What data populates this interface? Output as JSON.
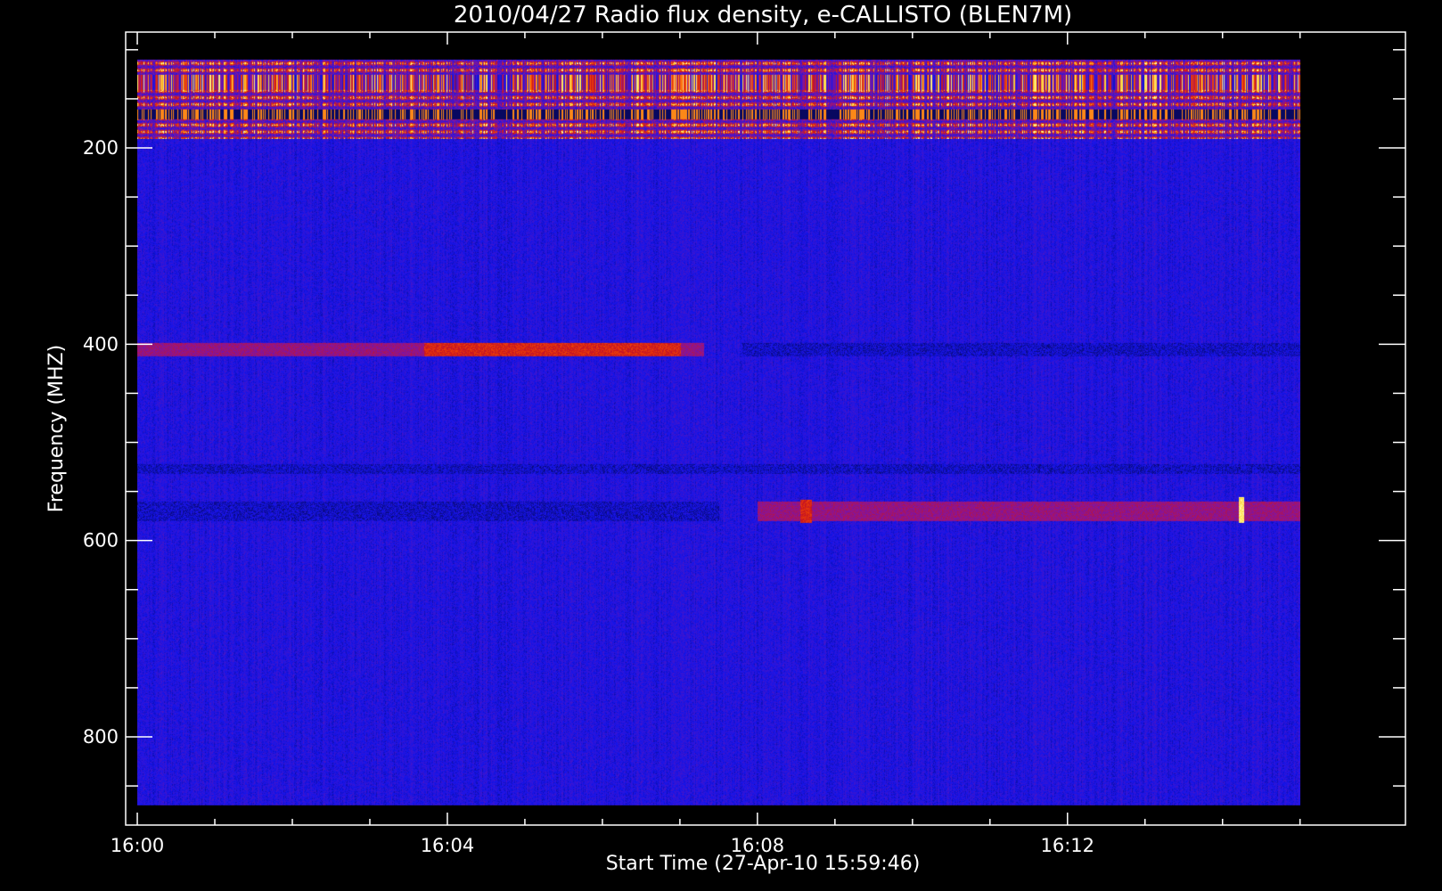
{
  "chart_data": {
    "type": "heatmap",
    "title": "2010/04/27  Radio flux density, e-CALLISTO (BLEN7M)",
    "xlabel": "Start Time (27-Apr-10 15:59:46)",
    "ylabel": "Frequency (MHZ)",
    "x_ticks": [
      "16:00",
      "16:04",
      "16:08",
      "16:12"
    ],
    "x_tick_minutes": [
      0,
      4,
      8,
      12
    ],
    "y_ticks": [
      200,
      400,
      600,
      800
    ],
    "xlim_minutes": [
      -0.15,
      16.36
    ],
    "ylim_mhz": [
      880,
      80
    ],
    "data_time_range_minutes": [
      0.0,
      15.0
    ],
    "data_freq_range_mhz": [
      110,
      870
    ],
    "grid": false,
    "colormap": [
      "#000000",
      "#0000e8",
      "#2a1ad8",
      "#c81414",
      "#ff6600",
      "#ffff80"
    ],
    "features": [
      {
        "kind": "interference-band",
        "freq_mhz": [
          110,
          190
        ],
        "intensity": "high"
      },
      {
        "kind": "emission-band",
        "freq_mhz": [
          398,
          412
        ],
        "time_minutes": [
          3.7,
          7.0
        ],
        "intensity": "high"
      },
      {
        "kind": "emission-band",
        "freq_mhz": [
          398,
          412
        ],
        "time_minutes": [
          0.0,
          7.3
        ],
        "intensity": "medium"
      },
      {
        "kind": "dark-band",
        "freq_mhz": [
          398,
          412
        ],
        "time_minutes": [
          7.8,
          15.0
        ],
        "intensity": "low"
      },
      {
        "kind": "dark-band",
        "freq_mhz": [
          522,
          532
        ],
        "time_minutes": [
          0.0,
          15.0
        ],
        "intensity": "low"
      },
      {
        "kind": "dark-band",
        "freq_mhz": [
          560,
          580
        ],
        "time_minutes": [
          0.0,
          7.5
        ],
        "intensity": "low"
      },
      {
        "kind": "emission-band",
        "freq_mhz": [
          560,
          580
        ],
        "time_minutes": [
          8.0,
          15.0
        ],
        "intensity": "medium"
      },
      {
        "kind": "burst",
        "freq_mhz": [
          558,
          582
        ],
        "time_minutes": [
          8.55,
          8.7
        ],
        "intensity": "high"
      },
      {
        "kind": "burst",
        "freq_mhz": [
          555,
          582
        ],
        "time_minutes": [
          14.2,
          14.27
        ],
        "intensity": "very-high"
      }
    ]
  }
}
